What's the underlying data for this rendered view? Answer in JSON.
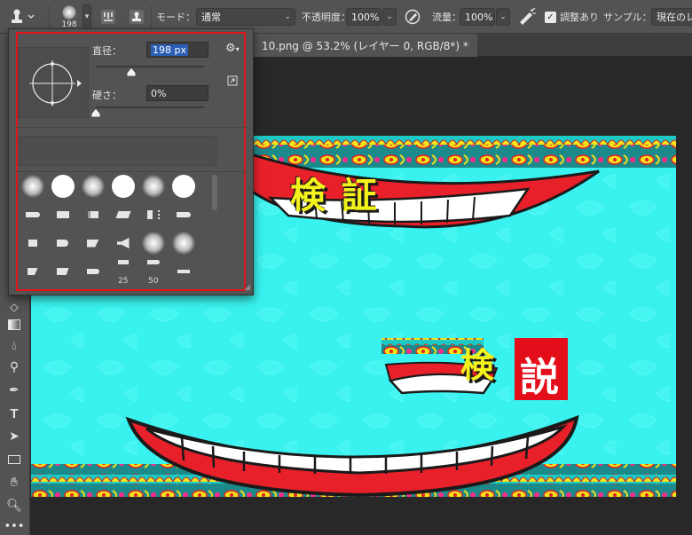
{
  "options_bar": {
    "brush_size": "198",
    "mode_label": "モード：",
    "mode_value": "通常",
    "opacity_label": "不透明度：",
    "opacity_value": "100%",
    "flow_label": "流量：",
    "flow_value": "100%",
    "adjust_checkbox_label": "調整あり",
    "adjust_checked": true,
    "sample_label": "サンプル：",
    "sample_value": "現在のレ"
  },
  "tab": {
    "title": "10.png @ 53.2% (レイヤー 0, RGB/8*) *"
  },
  "brush_popup": {
    "diameter_label": "直径：",
    "diameter_value": "198 px",
    "diameter_fraction": 0.33,
    "hardness_label": "硬さ：",
    "hardness_value": "0%",
    "hardness_fraction": 0.0,
    "size_labels": [
      "25",
      "50"
    ]
  },
  "canvas_text": {
    "top_left": "検 証",
    "mid_char1": "検",
    "mid_char2": "説"
  },
  "colors": {
    "canvas_bg": "#39f2ef",
    "lip_red": "#e8202a",
    "text_yellow": "#f4f21c",
    "highlight_red": "#e2121b",
    "selection_blue": "#2b5fb6"
  }
}
